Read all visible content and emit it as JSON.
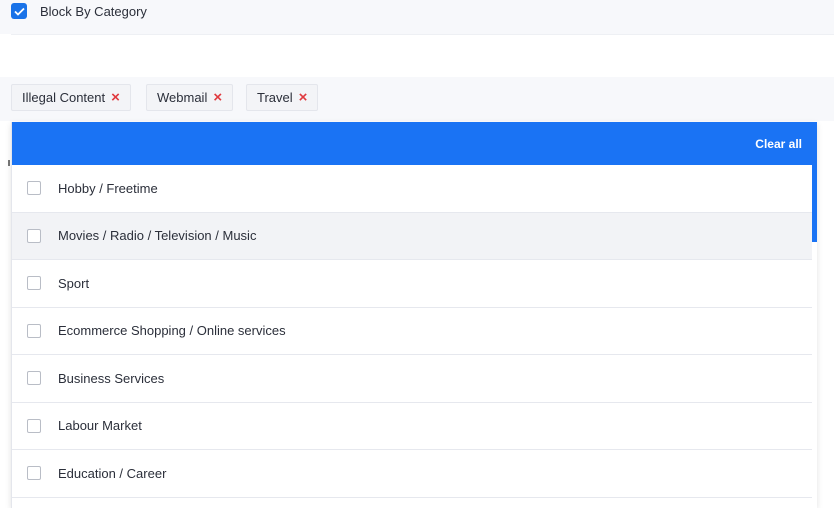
{
  "block_by_category": {
    "checked": true,
    "label": "Block By Category"
  },
  "selected_tags": [
    {
      "label": "Illegal Content"
    },
    {
      "label": "Webmail"
    },
    {
      "label": "Travel"
    }
  ],
  "dropdown": {
    "clear_all_label": "Clear all",
    "options": [
      {
        "label": "Hobby / Freetime",
        "checked": false
      },
      {
        "label": "Movies / Radio / Television / Music",
        "checked": false
      },
      {
        "label": "Sport",
        "checked": false
      },
      {
        "label": "Ecommerce Shopping / Online services",
        "checked": false
      },
      {
        "label": "Business Services",
        "checked": false
      },
      {
        "label": "Labour Market",
        "checked": false
      },
      {
        "label": "Education / Career",
        "checked": false
      }
    ]
  },
  "colors": {
    "accent": "#1a73f4",
    "remove_x": "#e0393e"
  },
  "icons": {
    "checkmark": "check-icon",
    "remove": "close-icon"
  }
}
